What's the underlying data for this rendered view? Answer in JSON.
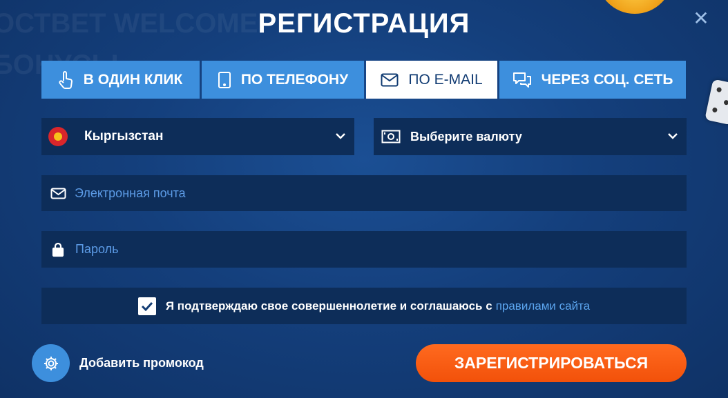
{
  "dialog": {
    "title": "РЕГИСТРАЦИЯ",
    "close_icon": "close-icon"
  },
  "background": {
    "line1": "ОСТВЕТ WELCOME",
    "line2": "БОНУСЫ"
  },
  "tabs": [
    {
      "label": "В ОДИН КЛИК",
      "icon": "hand-pointer-icon",
      "active": false
    },
    {
      "label": "ПО ТЕЛЕФОНУ",
      "icon": "phone-icon",
      "active": false
    },
    {
      "label": "ПО E-MAIL",
      "icon": "envelope-icon",
      "active": true
    },
    {
      "label": "ЧЕРЕЗ СОЦ. СЕТЬ",
      "icon": "chat-icon",
      "active": false
    }
  ],
  "form": {
    "country": {
      "value": "Кыргызстан",
      "icon": "kyrgyzstan-flag-icon"
    },
    "currency": {
      "placeholder": "Выберите валюту",
      "icon": "banknote-icon"
    },
    "email": {
      "placeholder": "Электронная почта",
      "icon": "envelope-icon"
    },
    "password": {
      "placeholder": "Пароль",
      "icon": "lock-icon"
    },
    "agreement": {
      "checked": true,
      "text": "Я подтверждаю свое совершеннолетие и соглашаюсь с",
      "link": "правилами сайта"
    }
  },
  "promo": {
    "label": "Добавить промокод",
    "icon": "gear-icon"
  },
  "submit": {
    "label": "ЗАРЕГИСТРИРОВАТЬСЯ"
  },
  "colors": {
    "background": "#143f7c",
    "tab": "#3d8fdd",
    "field": "#0d2d59",
    "placeholder": "#5c9be6",
    "accent": "#f2510a"
  }
}
